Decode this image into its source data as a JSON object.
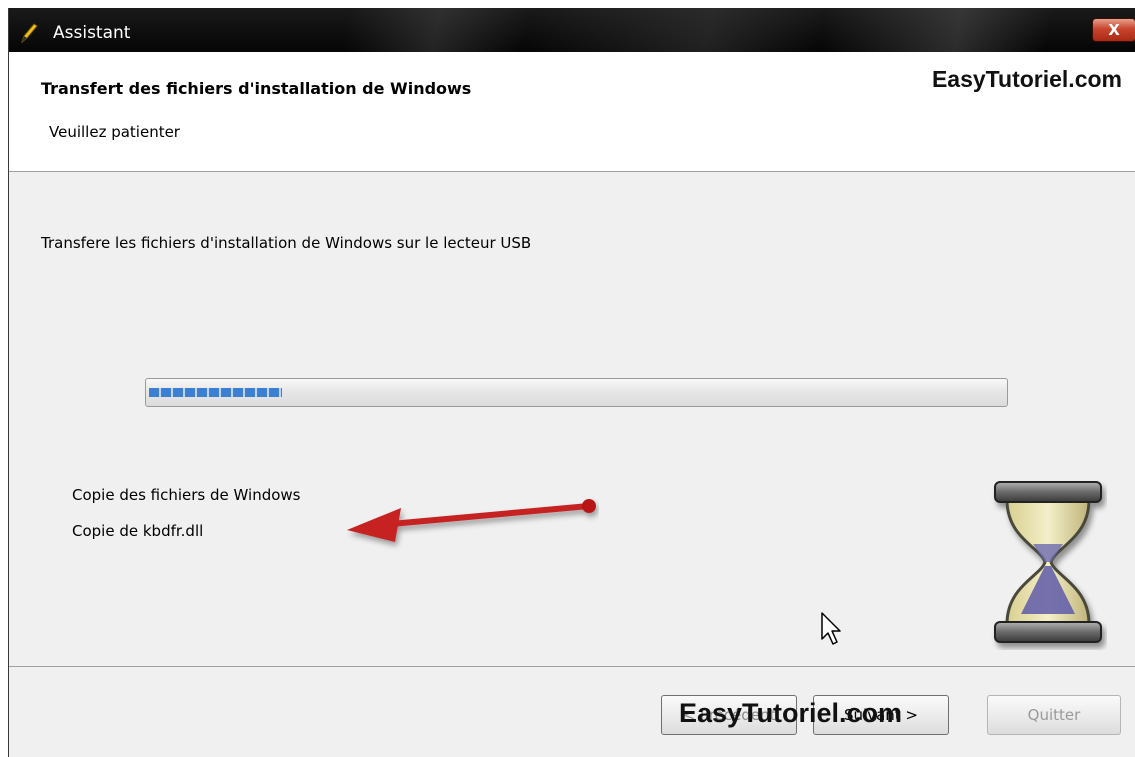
{
  "window": {
    "title": "Assistant",
    "close_glyph": "X"
  },
  "header": {
    "title": "Transfert des fichiers d'installation de Windows",
    "subtitle": "Veuillez patienter",
    "watermark": "EasyTutoriel.com"
  },
  "main": {
    "status": "Transfere les fichiers d'installation de Windows sur le lecteur USB",
    "progress_fraction": 0.155,
    "detail_line1": "Copie des fichiers de Windows",
    "detail_line2": "Copie de kbdfr.dll"
  },
  "footer": {
    "back_label": "< Précédent",
    "next_label": "Suivant >",
    "quit_label": "Quitter",
    "watermark": "EasyTutoriel.com"
  },
  "icons": {
    "title_icon": "pencil-icon",
    "busy_icon": "hourglass-icon",
    "annotation": "red-arrow",
    "pointer": "mouse-cursor-icon"
  },
  "colors": {
    "progress_fill": "#3d7fd0",
    "arrow": "#c62020",
    "close_button": "#c8452d"
  }
}
